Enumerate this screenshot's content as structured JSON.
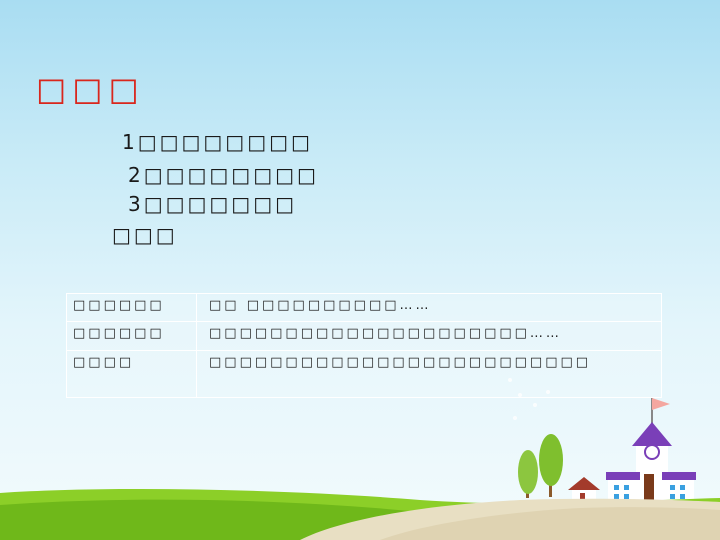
{
  "slide": {
    "title": "□□□",
    "lines": [
      "1□□□□□□□□",
      "2□□□□□□□□",
      "3□□□□□□□",
      "□□□"
    ]
  },
  "table": {
    "rows": [
      {
        "label": "□□□□□□",
        "content": "□□ □□□□□□□□□□……"
      },
      {
        "label": "□□□□□□",
        "content": "□□□□□□□□□□□□□□□□□□□□□……"
      },
      {
        "label": "□□□□",
        "content": "□□□□□□□□□□□□□□□□□□□□□□□□□"
      }
    ]
  },
  "colors": {
    "title": "#d9261c",
    "sky_top": "#a9ddf2",
    "grass": "#7cc21e",
    "path": "#e6dcc0",
    "building_roof": "#7a3fb8"
  }
}
